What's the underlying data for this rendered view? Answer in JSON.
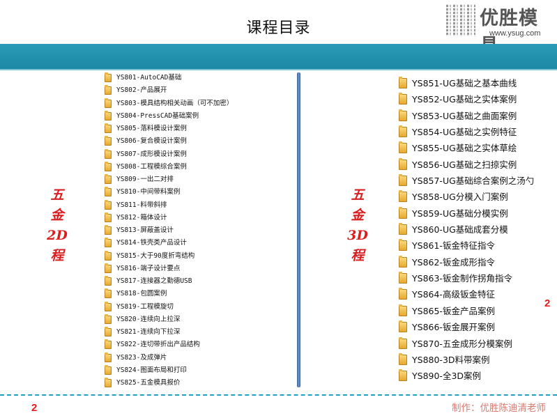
{
  "title": "课程目录",
  "logo": {
    "name": "优胜模具",
    "url": "www.ysug.com"
  },
  "left_label": [
    "五",
    "金",
    "2D",
    "程"
  ],
  "right_label": [
    "五",
    "金",
    "3D",
    "程"
  ],
  "list_2d": [
    "YS801-AutoCAD基础",
    "YS802-产品展开",
    "YS803-模具结构相关动画（可不加密）",
    "YS804-PressCAD基础案例",
    "YS805-落料模设计案例",
    "YS806-复合模设计案例",
    "YS807-成形模设计案例",
    "YS808-工程模综合案例",
    "YS809-一出二对排",
    "YS810-中间带料案例",
    "YS811-料带斜排",
    "YS812-箱体设计",
    "YS813-屏蔽盖设计",
    "YS814-铁壳类产品设计",
    "YS815-大于90度折弯结构",
    "YS816-端子设计要点",
    "YS817-连接器之勤德USB",
    "YS818-包圆案例",
    "YS819-工程模旋切",
    "YS820-连续向上拉深",
    "YS821-连续向下拉深",
    "YS822-连切带折出产品结构",
    "YS823-及成弹片",
    "YS824-图面布局和打印",
    "YS825-五金模具报价"
  ],
  "list_3d": [
    "YS851-UG基础之基本曲线",
    "YS852-UG基础之实体案例",
    "YS853-UG基础之曲面案例",
    "YS854-UG基础之实例特征",
    "YS855-UG基础之实体草绘",
    "YS856-UG基础之扫掠实例",
    "YS857-UG基础综合案例之汤勺",
    "YS858-UG分模入门案例",
    "YS859-UG基础分模实例",
    "YS860-UG基础成套分模",
    "YS861-钣金特征指令",
    "YS862-钣金成形指令",
    "YS863-钣金制作拐角指令",
    "YS864-高级钣金特征",
    "YS865-钣金产品案例",
    "YS866-钣金展开案例",
    "YS870-五金成形分模案例",
    "YS880-3D料带案例",
    "YS890-全3D案例"
  ],
  "page_number_right": "2",
  "page_number_left": "2",
  "credit": "制作：优胜陈迪清老师",
  "colors": {
    "band": "#1f8fab",
    "label_red": "#d81e1e",
    "divider": "#4a6fa5"
  },
  "icons": {
    "list_item": "folder-icon"
  }
}
